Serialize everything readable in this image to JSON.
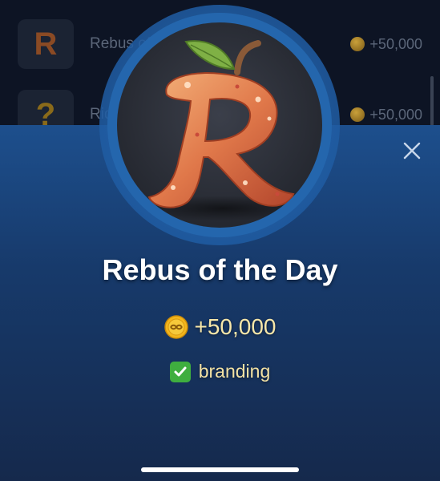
{
  "background_list": {
    "items": [
      {
        "title": "Rebus of",
        "reward": "+50,000",
        "thumb": "R"
      },
      {
        "title": "Rid",
        "reward": "+50,000",
        "thumb": "?"
      }
    ]
  },
  "modal": {
    "close_icon": "close-icon",
    "avatar_letter": "R",
    "title": "Rebus of the Day",
    "reward": "+50,000",
    "tag_label": "branding",
    "tag_icon": "check-box-icon",
    "colors": {
      "sheet_top": "#1d4f8d",
      "sheet_bottom": "#15294c",
      "ring": "#2466ad",
      "reward_text": "#f7e7a9",
      "coin": "#f2b51c"
    }
  }
}
